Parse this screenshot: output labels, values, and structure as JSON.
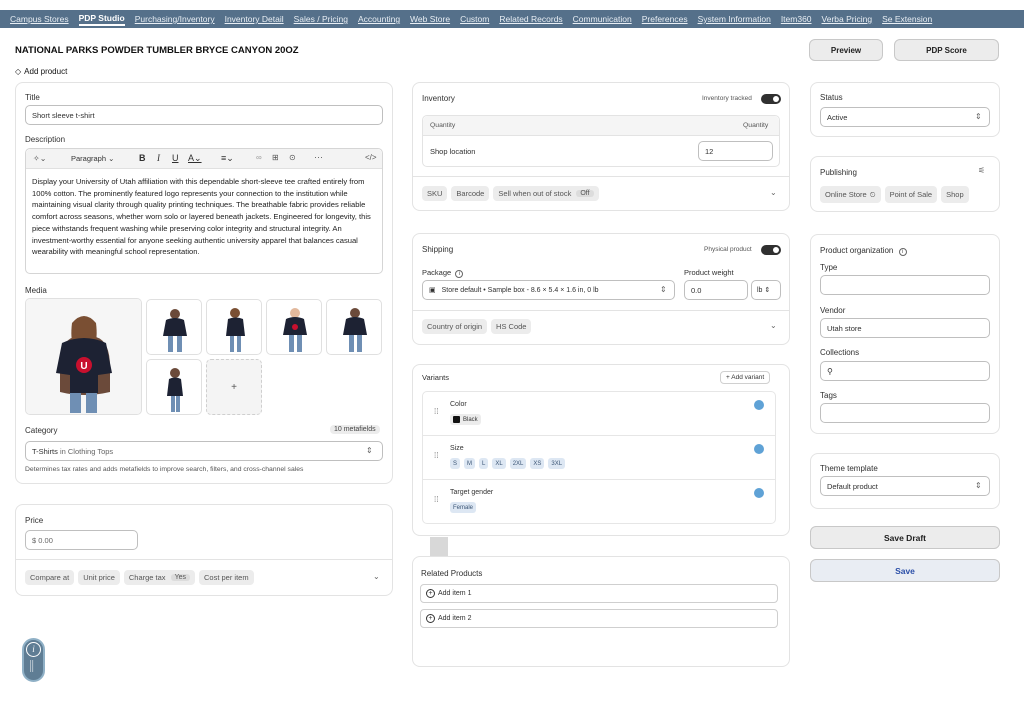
{
  "nav": {
    "tabs": [
      {
        "label": "Campus Stores",
        "active": false
      },
      {
        "label": "PDP Studio",
        "active": true
      },
      {
        "label": "Purchasing/Inventory",
        "active": false
      },
      {
        "label": "Inventory Detail",
        "active": false
      },
      {
        "label": "Sales / Pricing",
        "active": false
      },
      {
        "label": "Accounting",
        "active": false
      },
      {
        "label": "Web Store",
        "active": false
      },
      {
        "label": "Custom",
        "active": false
      },
      {
        "label": "Related Records",
        "active": false
      },
      {
        "label": "Communication",
        "active": false
      },
      {
        "label": "Preferences",
        "active": false
      },
      {
        "label": "System Information",
        "active": false
      },
      {
        "label": "Item360",
        "active": false
      },
      {
        "label": "Verba Pricing",
        "active": false
      },
      {
        "label": "Se Extension",
        "active": false
      }
    ]
  },
  "page": {
    "title": "NATIONAL PARKS POWDER TUMBLER BRYCE CANYON 20OZ",
    "add_product": "Add product"
  },
  "header_buttons": {
    "preview": "Preview",
    "pdp_score": "PDP Score"
  },
  "product": {
    "title_label": "Title",
    "title_value": "Short sleeve t-shirt",
    "description_label": "Description",
    "toolbar": {
      "paragraph": "Paragraph"
    },
    "description": "Display your University of Utah affiliation with this dependable short-sleeve tee crafted entirely from 100% cotton. The prominently featured logo represents your connection to the institution while maintaining visual clarity through quality printing techniques. The breathable fabric provides reliable comfort across seasons, whether worn solo or layered beneath jackets. Engineered for longevity, this piece withstands frequent washing while preserving color integrity and structural integrity. An investment-worthy essential for anyone seeking authentic university apparel that balances casual wearability with meaningful school representation.",
    "media_label": "Media",
    "add_media": "+",
    "category_label": "Category",
    "metafields": "10 metafields",
    "category_value_a": "T-Shirts",
    "category_value_b": "in Clothing Tops",
    "category_help": "Determines tax rates and adds metafields to improve search, filters, and cross-channel sales"
  },
  "price": {
    "label": "Price",
    "currency": "$",
    "value": "0.00",
    "compare_at": "Compare at",
    "unit_price": "Unit price",
    "charge_tax": "Charge tax",
    "charge_tax_value": "Yes",
    "cost_per_item": "Cost per item"
  },
  "inventory": {
    "title": "Inventory",
    "tracked_label": "Inventory tracked",
    "col_quantity": "Quantity",
    "col_quantity_right": "Quantity",
    "location": "Shop location",
    "quantity": "12",
    "sku": "SKU",
    "barcode": "Barcode",
    "sell_oos": "Sell when out of stock",
    "sell_oos_value": "Off"
  },
  "shipping": {
    "title": "Shipping",
    "physical_label": "Physical product",
    "package_label": "Package",
    "package_value": "Store default • Sample box - 8.6 × 5.4 × 1.6 in, 0 lb",
    "weight_label": "Product weight",
    "weight_value": "0.0",
    "weight_unit": "lb",
    "country": "Country of origin",
    "hs_code": "HS Code"
  },
  "variants": {
    "title": "Variants",
    "add": "+ Add variant",
    "color_label": "Color",
    "color_value": "Black",
    "size_label": "Size",
    "sizes": [
      "S",
      "M",
      "L",
      "XL",
      "2XL",
      "XS",
      "3XL"
    ],
    "gender_label": "Target gender",
    "gender_value": "Female"
  },
  "related": {
    "title": "Related Products",
    "item1": "Add item 1",
    "item2": "Add item 2"
  },
  "status": {
    "label": "Status",
    "value": "Active"
  },
  "publishing": {
    "label": "Publishing",
    "channels": [
      "Online Store",
      "Point of Sale",
      "Shop"
    ]
  },
  "organization": {
    "label": "Product organization",
    "type_label": "Type",
    "type_value": "",
    "vendor_label": "Vendor",
    "vendor_value": "Utah store",
    "collections_label": "Collections",
    "tags_label": "Tags"
  },
  "theme": {
    "label": "Theme template",
    "value": "Default product"
  },
  "actions": {
    "save_draft": "Save Draft",
    "save": "Save"
  },
  "colors": {
    "nav": "#55708a",
    "save_text": "#2b4fa8",
    "variant_icon": "#5fa2d6"
  }
}
